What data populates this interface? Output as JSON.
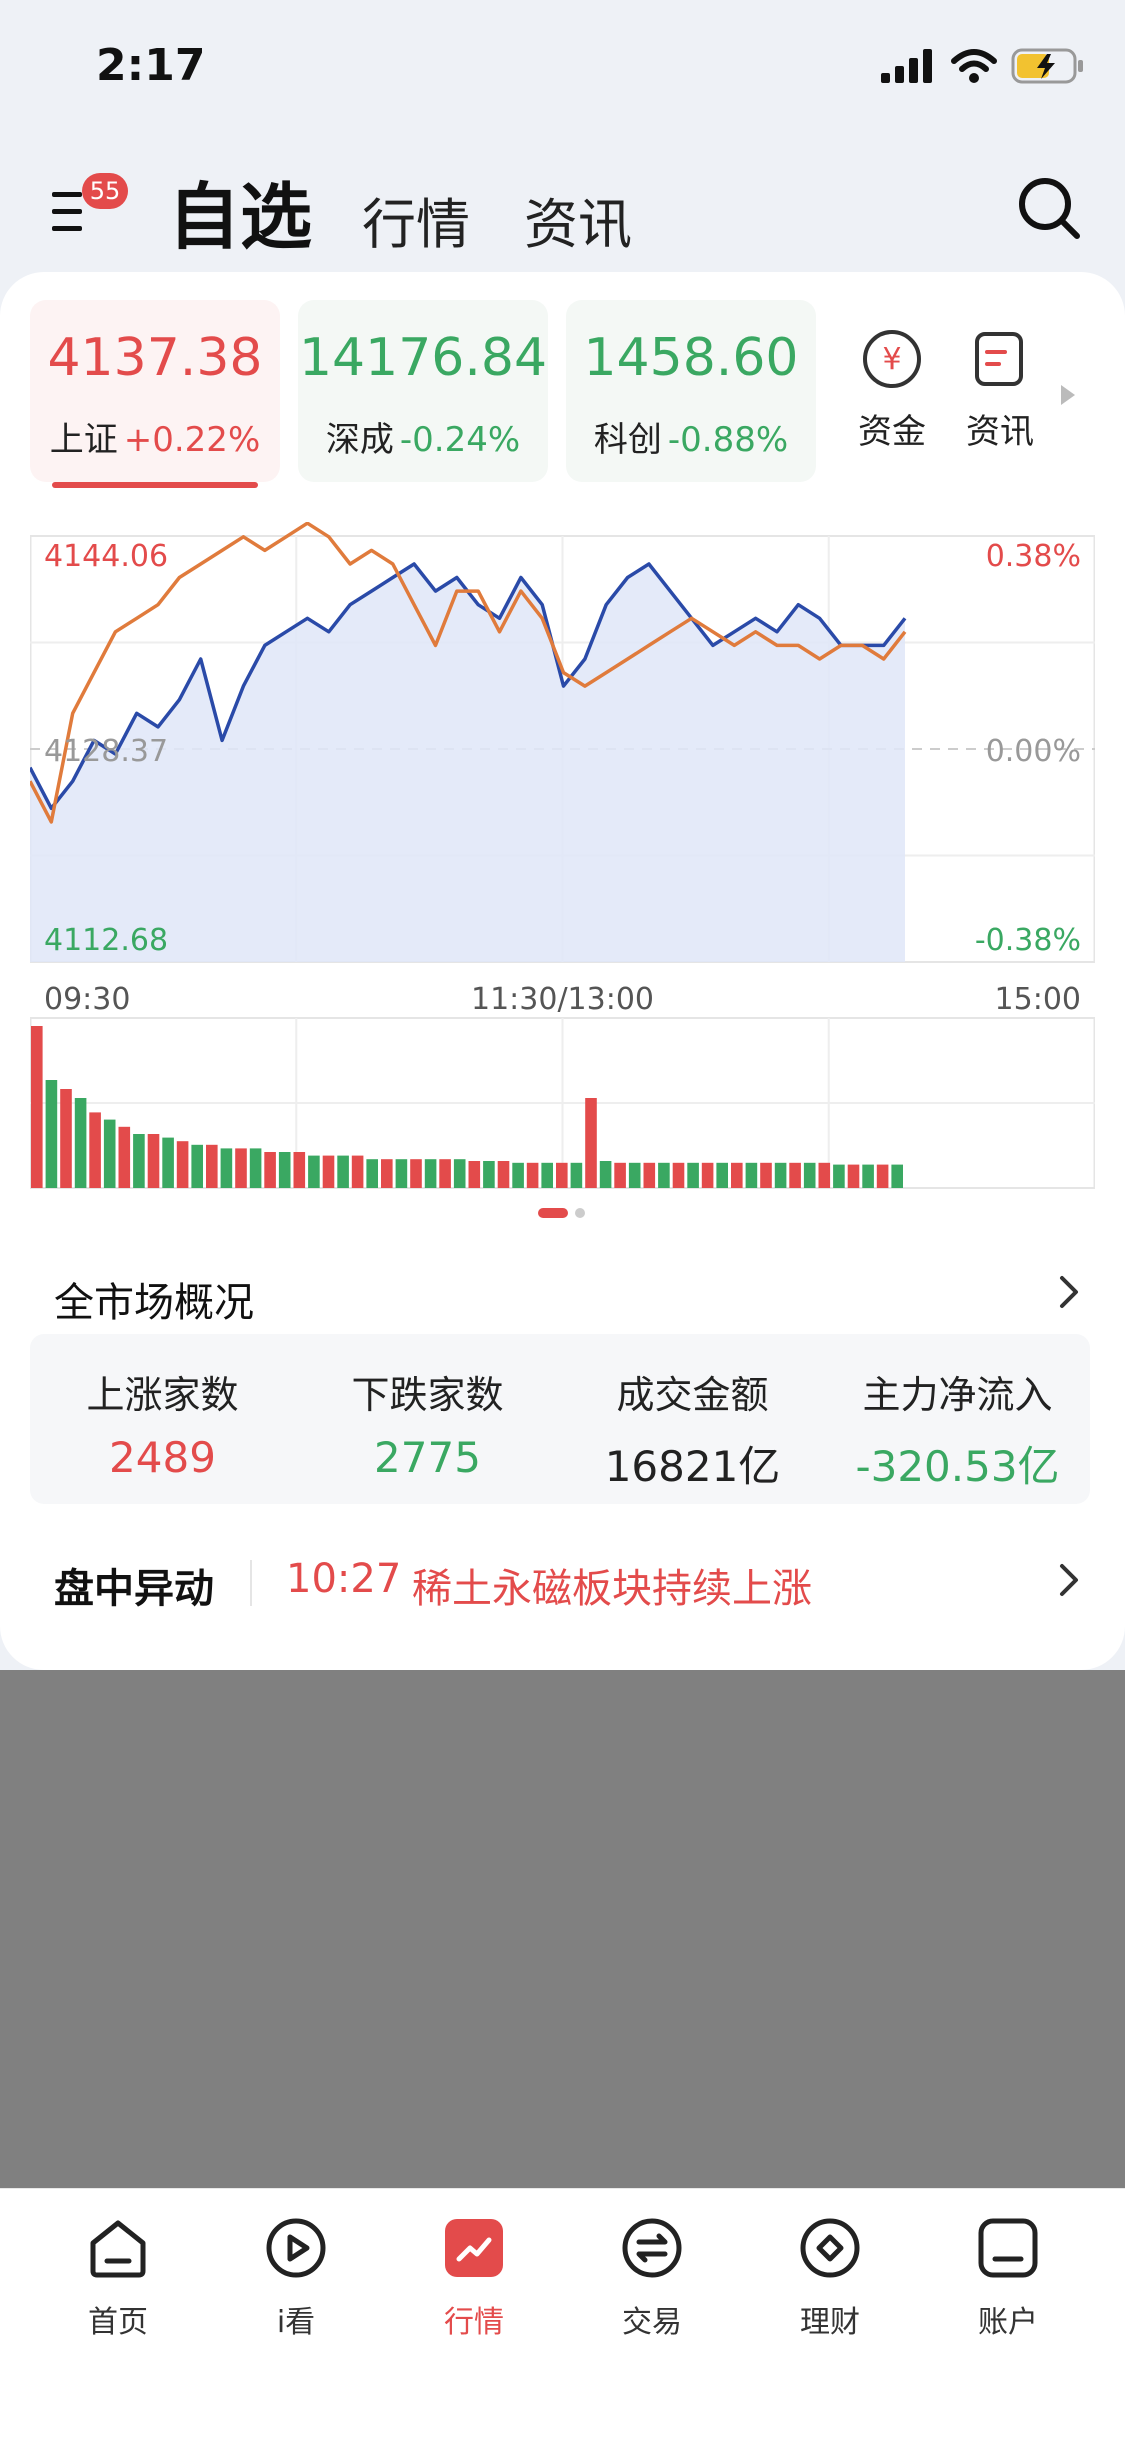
{
  "status": {
    "time": "2:17"
  },
  "header": {
    "badge": "55",
    "tabs": [
      {
        "label": "自选"
      },
      {
        "label": "行情"
      },
      {
        "label": "资讯"
      }
    ]
  },
  "indices": [
    {
      "value": "4137.38",
      "name": "上证",
      "change": "+0.22%"
    },
    {
      "value": "14176.84",
      "name": "深成",
      "change": "-0.24%"
    },
    {
      "value": "1458.60",
      "name": "科创",
      "change": "-0.88%"
    }
  ],
  "quick_links": [
    {
      "label": "资金",
      "icon": "yuan-circle-icon"
    },
    {
      "label": "资讯",
      "icon": "news-icon"
    }
  ],
  "chart_data": {
    "type": "line",
    "title": "",
    "y_left_labels": [
      "4144.06",
      "4128.37",
      "4112.68"
    ],
    "y_right_labels": [
      "0.38%",
      "0.00%",
      "-0.38%"
    ],
    "x_labels": [
      "09:30",
      "11:30/13:00",
      "15:00"
    ],
    "ylim": [
      4112.68,
      4144.06
    ],
    "baseline": 4128.37,
    "series": [
      {
        "name": "",
        "color": "#2a4aa8",
        "values": [
          4127,
          4124,
          4126,
          4129,
          4128,
          4131,
          4130,
          4132,
          4135,
          4129,
          4133,
          4136,
          4137,
          4138,
          4137,
          4139,
          4140,
          4141,
          4142,
          4140,
          4141,
          4139,
          4138,
          4141,
          4139,
          4133,
          4135,
          4139,
          4141,
          4142,
          4140,
          4138,
          4136,
          4137,
          4138,
          4137,
          4139,
          4138,
          4136,
          4136,
          4136,
          4138
        ]
      },
      {
        "name": "",
        "color": "#e07b3c",
        "values": [
          4126,
          4123,
          4131,
          4134,
          4137,
          4138,
          4139,
          4141,
          4142,
          4143,
          4144,
          4143,
          4144,
          4145,
          4144,
          4142,
          4143,
          4142,
          4139,
          4136,
          4140,
          4140,
          4137,
          4140,
          4138,
          4134,
          4133,
          4134,
          4135,
          4136,
          4137,
          4138,
          4137,
          4136,
          4137,
          4136,
          4136,
          4135,
          4136,
          4136,
          4135,
          4137
        ]
      }
    ],
    "volume": [
      90,
      60,
      55,
      50,
      42,
      38,
      34,
      30,
      30,
      28,
      26,
      24,
      24,
      22,
      22,
      22,
      20,
      20,
      20,
      18,
      18,
      18,
      18,
      16,
      16,
      16,
      16,
      16,
      16,
      16,
      15,
      15,
      15,
      14,
      14,
      14,
      14,
      14,
      50,
      15,
      14,
      14,
      14,
      14,
      14,
      14,
      14,
      14,
      14,
      14,
      14,
      14,
      14,
      14,
      14,
      13,
      13,
      13,
      13,
      13
    ]
  },
  "overview": {
    "title": "全市场概况",
    "items": [
      {
        "label": "上涨家数",
        "value": "2489"
      },
      {
        "label": "下跌家数",
        "value": "2775"
      },
      {
        "label": "成交金额",
        "value": "16821亿"
      },
      {
        "label": "主力净流入",
        "value": "-320.53亿"
      }
    ]
  },
  "alert": {
    "label": "盘中异动",
    "time": "10:27",
    "message": "稀土永磁板块持续上涨"
  },
  "nav": [
    {
      "label": "首页",
      "icon": "home-icon"
    },
    {
      "label": "i看",
      "icon": "play-icon"
    },
    {
      "label": "行情",
      "icon": "market-icon"
    },
    {
      "label": "交易",
      "icon": "exchange-icon"
    },
    {
      "label": "理财",
      "icon": "diamond-icon"
    },
    {
      "label": "账户",
      "icon": "account-icon"
    }
  ],
  "colors": {
    "up": "#e34b4b",
    "down": "#3aa862",
    "accent": "#e34b4b"
  }
}
